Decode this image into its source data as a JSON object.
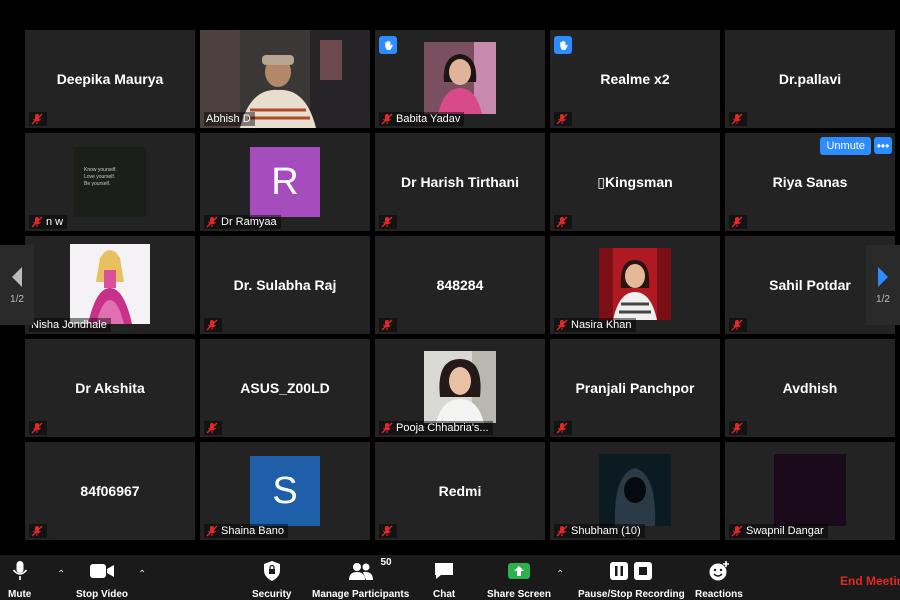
{
  "pager": {
    "left": "1/2",
    "right": "1/2"
  },
  "tiles": [
    {
      "name": "Deepika Maurya"
    },
    {
      "label": "Abhish D"
    },
    {
      "label": "Babita Yadav"
    },
    {
      "name": "Realme x2"
    },
    {
      "name": "Dr.pallavi"
    },
    {
      "label": "n w",
      "quote": [
        "Know yourself.",
        "Love yourself.",
        "Be yourself."
      ]
    },
    {
      "label": "Dr Ramyaa",
      "initial": "R"
    },
    {
      "name": "Dr Harish Tirthani"
    },
    {
      "name": "▯Kingsman"
    },
    {
      "name": "Riya Sanas",
      "unmute": "Unmute",
      "more": "•••"
    },
    {
      "label": "Nisha Jondhale"
    },
    {
      "name": "Dr. Sulabha Raj"
    },
    {
      "name": "848284"
    },
    {
      "label": "Nasira Khan"
    },
    {
      "name": "Sahil Potdar"
    },
    {
      "name": "Dr Akshita"
    },
    {
      "name": "ASUS_Z00LD"
    },
    {
      "label": "Pooja Chhabria's..."
    },
    {
      "name": "Pranjali Panchpor"
    },
    {
      "name": "Avdhish"
    },
    {
      "name": "84f06967"
    },
    {
      "label": "Shaina Bano",
      "initial": "S"
    },
    {
      "name": "Redmi"
    },
    {
      "label": "Shubham (10)"
    },
    {
      "label": "Swapnil Dangar"
    }
  ],
  "toolbar": {
    "mute": "Mute",
    "stop_video": "Stop Video",
    "security": "Security",
    "participants": "Manage Participants",
    "participants_count": "50",
    "chat": "Chat",
    "share": "Share Screen",
    "record": "Pause/Stop Recording",
    "reactions": "Reactions",
    "end": "End Meeting"
  },
  "colors": {
    "accent": "#2d8cff",
    "active_border": "#a6e22e",
    "avatar_r": "#a64dbe",
    "avatar_s": "#1f5ea8",
    "share": "#2bb24c",
    "end": "#e02828"
  }
}
